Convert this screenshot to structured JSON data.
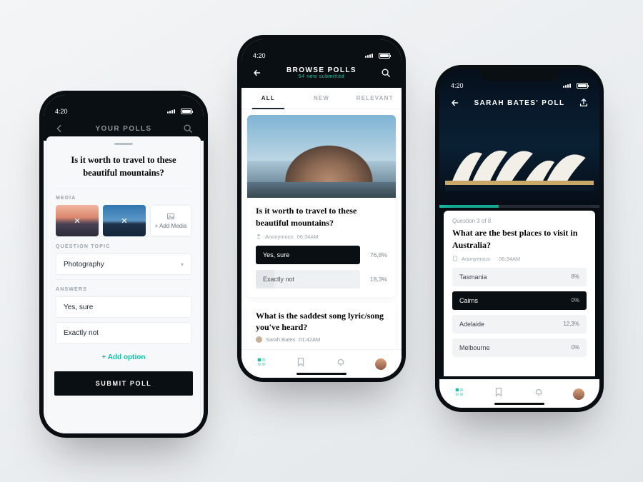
{
  "status_time": "4:20",
  "phone1": {
    "header_title": "YOUR POLLS",
    "question": "Is it worth to travel to these beautiful mountains?",
    "section_media": "MEDIA",
    "add_media": "+ Add Media",
    "section_topic": "QUESTION TOPIC",
    "topic_value": "Photography",
    "section_answers": "ANSWERS",
    "answers": {
      "a0": "Yes, sure",
      "a1": "Exactly not"
    },
    "add_option": "+ Add option",
    "submit": "SUBMIT POLL"
  },
  "phone2": {
    "header_title": "BROWSE POLLS",
    "header_sub": "54 new submitted",
    "tabs": {
      "t0": "ALL",
      "t1": "NEW",
      "t2": "RELEVANT"
    },
    "card1": {
      "question": "Is it worth to travel to these beautiful mountains?",
      "author": "Anonymous",
      "time": "06:34AM",
      "option1_label": "Yes, sure",
      "option1_pct": "76,8%",
      "option2_label": "Exactly not",
      "option2_pct": "18,3%"
    },
    "card2": {
      "question": "What is the saddest song lyric/song you've heard?",
      "author": "Sarah Bates",
      "time": "01:42AM"
    }
  },
  "phone3": {
    "header_title": "SARAH BATES' POLL",
    "question_counter": "Question 3 of 8",
    "question": "What are the best places to visit in Australia?",
    "author": "Anonymous",
    "time": "06:34AM",
    "options": {
      "o0": {
        "label": "Tasmania",
        "pct": "8%"
      },
      "o1": {
        "label": "Cairns",
        "pct": "0%"
      },
      "o2": {
        "label": "Adelaide",
        "pct": "12,3%"
      },
      "o3": {
        "label": "Melbourne",
        "pct": "0%"
      }
    }
  }
}
